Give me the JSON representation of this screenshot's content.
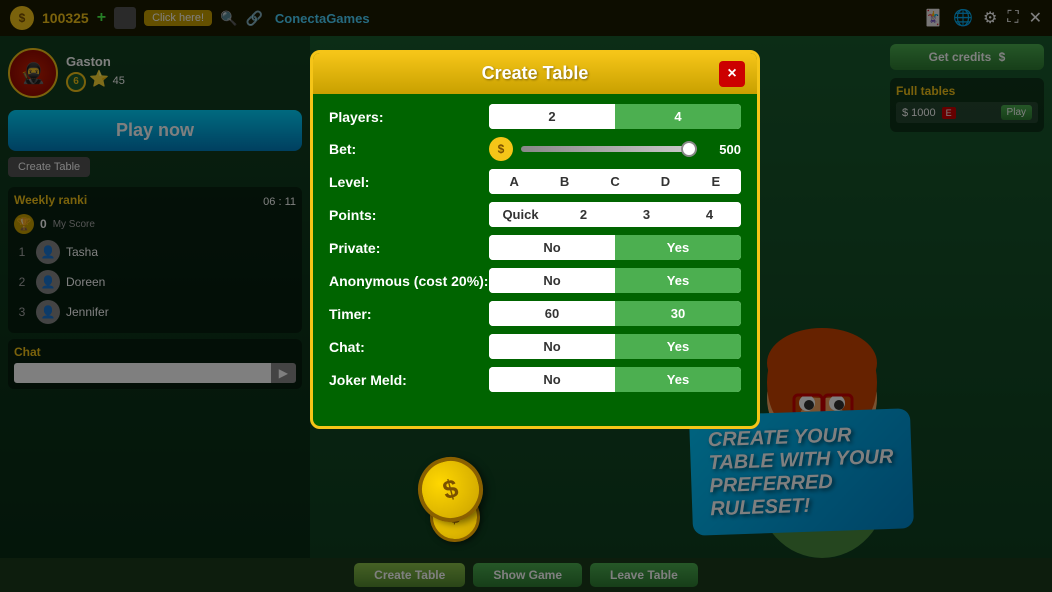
{
  "topbar": {
    "score": "100325",
    "click_here": "Click here!",
    "logo": "ConectaGames",
    "icons": [
      "🃏",
      "🌐",
      "⚙",
      "✕✕",
      "✕"
    ]
  },
  "profile": {
    "name": "Gaston",
    "level": "6",
    "score_label": "45"
  },
  "buttons": {
    "play_now": "Play now",
    "create_table_small": "Create Table",
    "get_credits": "Get credits",
    "create_table_main": "Create Table",
    "show_game": "Show Game",
    "leave_table": "Leave Table"
  },
  "weekly_ranking": {
    "title": "Weekly ranki",
    "timer": "06 : 11",
    "my_score": "My Score",
    "zero_label": "0",
    "players": [
      {
        "rank": "1",
        "name": "Tasha"
      },
      {
        "rank": "2",
        "name": "Doreen"
      },
      {
        "rank": "3",
        "name": "Jennifer"
      }
    ]
  },
  "full_tables": {
    "title": "Full tables",
    "items": [
      {
        "amount": "$ 1000",
        "tag": "E",
        "action": "Play"
      }
    ]
  },
  "chat": {
    "title": "Chat"
  },
  "modal": {
    "title": "Create Table",
    "close": "×",
    "fields": {
      "players": {
        "label": "Players:",
        "options": [
          "2",
          "4"
        ],
        "active": "4"
      },
      "bet": {
        "label": "Bet:",
        "value": "500"
      },
      "level": {
        "label": "Level:",
        "options": [
          "A",
          "B",
          "C",
          "D",
          "E"
        ],
        "active": ""
      },
      "points": {
        "label": "Points:",
        "options": [
          "Quick",
          "2",
          "3",
          "4"
        ],
        "active": ""
      },
      "private": {
        "label": "Private:",
        "options": [
          "No",
          "Yes"
        ],
        "active": "Yes"
      },
      "anonymous": {
        "label": "Anonymous (cost 20%):",
        "options": [
          "No",
          "Yes"
        ],
        "active": "Yes"
      },
      "timer": {
        "label": "Timer:",
        "options": [
          "60",
          "30"
        ],
        "active": "30"
      },
      "chat": {
        "label": "Chat:",
        "options": [
          "No",
          "Yes"
        ],
        "active": "Yes"
      },
      "joker_meld": {
        "label": "Joker Meld:",
        "options": [
          "No",
          "Yes"
        ],
        "active": "Yes"
      }
    }
  },
  "cta": {
    "line1": "CREATE YOUR",
    "line2": "TABLE WITH YOUR",
    "line3": "PREFERRED",
    "line4": "RULESET!"
  }
}
